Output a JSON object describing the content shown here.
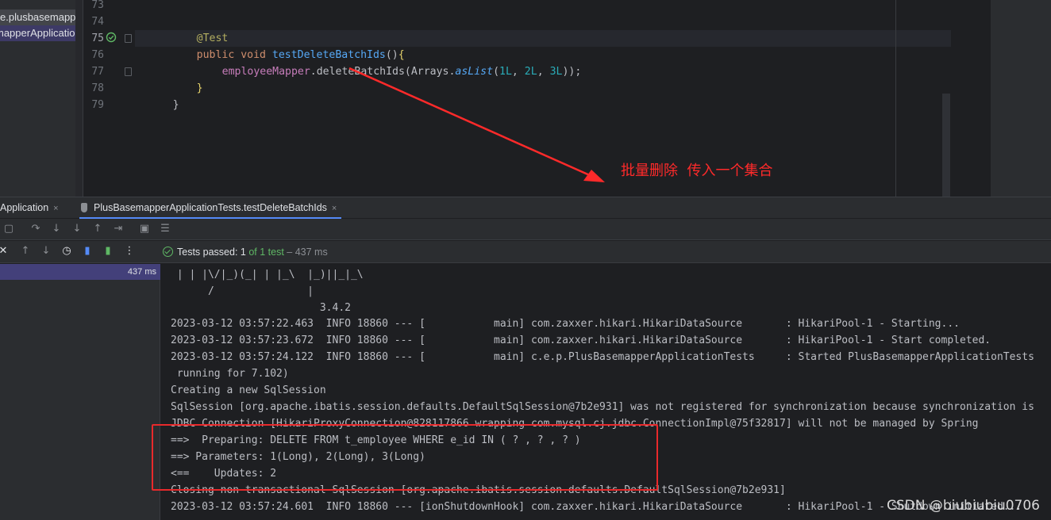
{
  "project": {
    "items": [
      "e.plusbasemappe",
      "mapperApplicatio"
    ]
  },
  "editor": {
    "line_numbers": [
      "73",
      "74",
      "75",
      "76",
      "77",
      "78",
      "79"
    ],
    "code": {
      "l74": "@Test",
      "l75_kw": "public void ",
      "l75_fn": "testDeleteBatchIds",
      "l75_rest": "()",
      "l75_brace": "{",
      "l76_field": "employeeMapper",
      "l76_dot": ".deleteBatchIds(Arrays.",
      "l76_method": "asList",
      "l76_open": "(",
      "l76_n1": "1L",
      "l76_sep1": ", ",
      "l76_n2": "2L",
      "l76_sep2": ", ",
      "l76_n3": "3L",
      "l76_close": "));",
      "l77": "}",
      "l78": "}"
    }
  },
  "annotation": {
    "text": "批量删除  传入一个集合"
  },
  "run_window": {
    "tabs": [
      {
        "label": "Application",
        "close": "×"
      },
      {
        "label": "PlusBasemapperApplicationTests.testDeleteBatchIds",
        "close": "×"
      }
    ],
    "status": {
      "prefix": "Tests passed: ",
      "passed": "1",
      "of": " of 1 test",
      "duration": " – 437 ms"
    },
    "tree": {
      "duration": "437 ms"
    },
    "console_lines": [
      " | | |\\/|_)(_| | |_\\  |_)||_|_\\",
      "      /               |",
      "                        3.4.2",
      "2023-03-12 03:57:22.463  INFO 18860 --- [           main] com.zaxxer.hikari.HikariDataSource       : HikariPool-1 - Starting...",
      "2023-03-12 03:57:23.672  INFO 18860 --- [           main] com.zaxxer.hikari.HikariDataSource       : HikariPool-1 - Start completed.",
      "2023-03-12 03:57:24.122  INFO 18860 --- [           main] c.e.p.PlusBasemapperApplicationTests     : Started PlusBasemapperApplicationTests",
      " running for 7.102)",
      "Creating a new SqlSession",
      "SqlSession [org.apache.ibatis.session.defaults.DefaultSqlSession@7b2e931] was not registered for synchronization because synchronization is",
      "JDBC Connection [HikariProxyConnection@828117866 wrapping com.mysql.cj.jdbc.ConnectionImpl@75f32817] will not be managed by Spring",
      "==>  Preparing: DELETE FROM t_employee WHERE e_id IN ( ? , ? , ? )",
      "==> Parameters: 1(Long), 2(Long), 3(Long)",
      "<==    Updates: 2",
      "Closing non transactional SqlSession [org.apache.ibatis.session.defaults.DefaultSqlSession@7b2e931]",
      "2023-03-12 03:57:24.601  INFO 18860 --- [ionShutdownHook] com.zaxxer.hikari.HikariDataSource       : HikariPool-1 - Shutdown initiated..."
    ]
  },
  "watermark": "CSDN @biubiubiu0706",
  "colors": {
    "annotation_red": "#ff2a2a",
    "passed_green": "#5fb865",
    "selection_purple": "#43407a"
  }
}
